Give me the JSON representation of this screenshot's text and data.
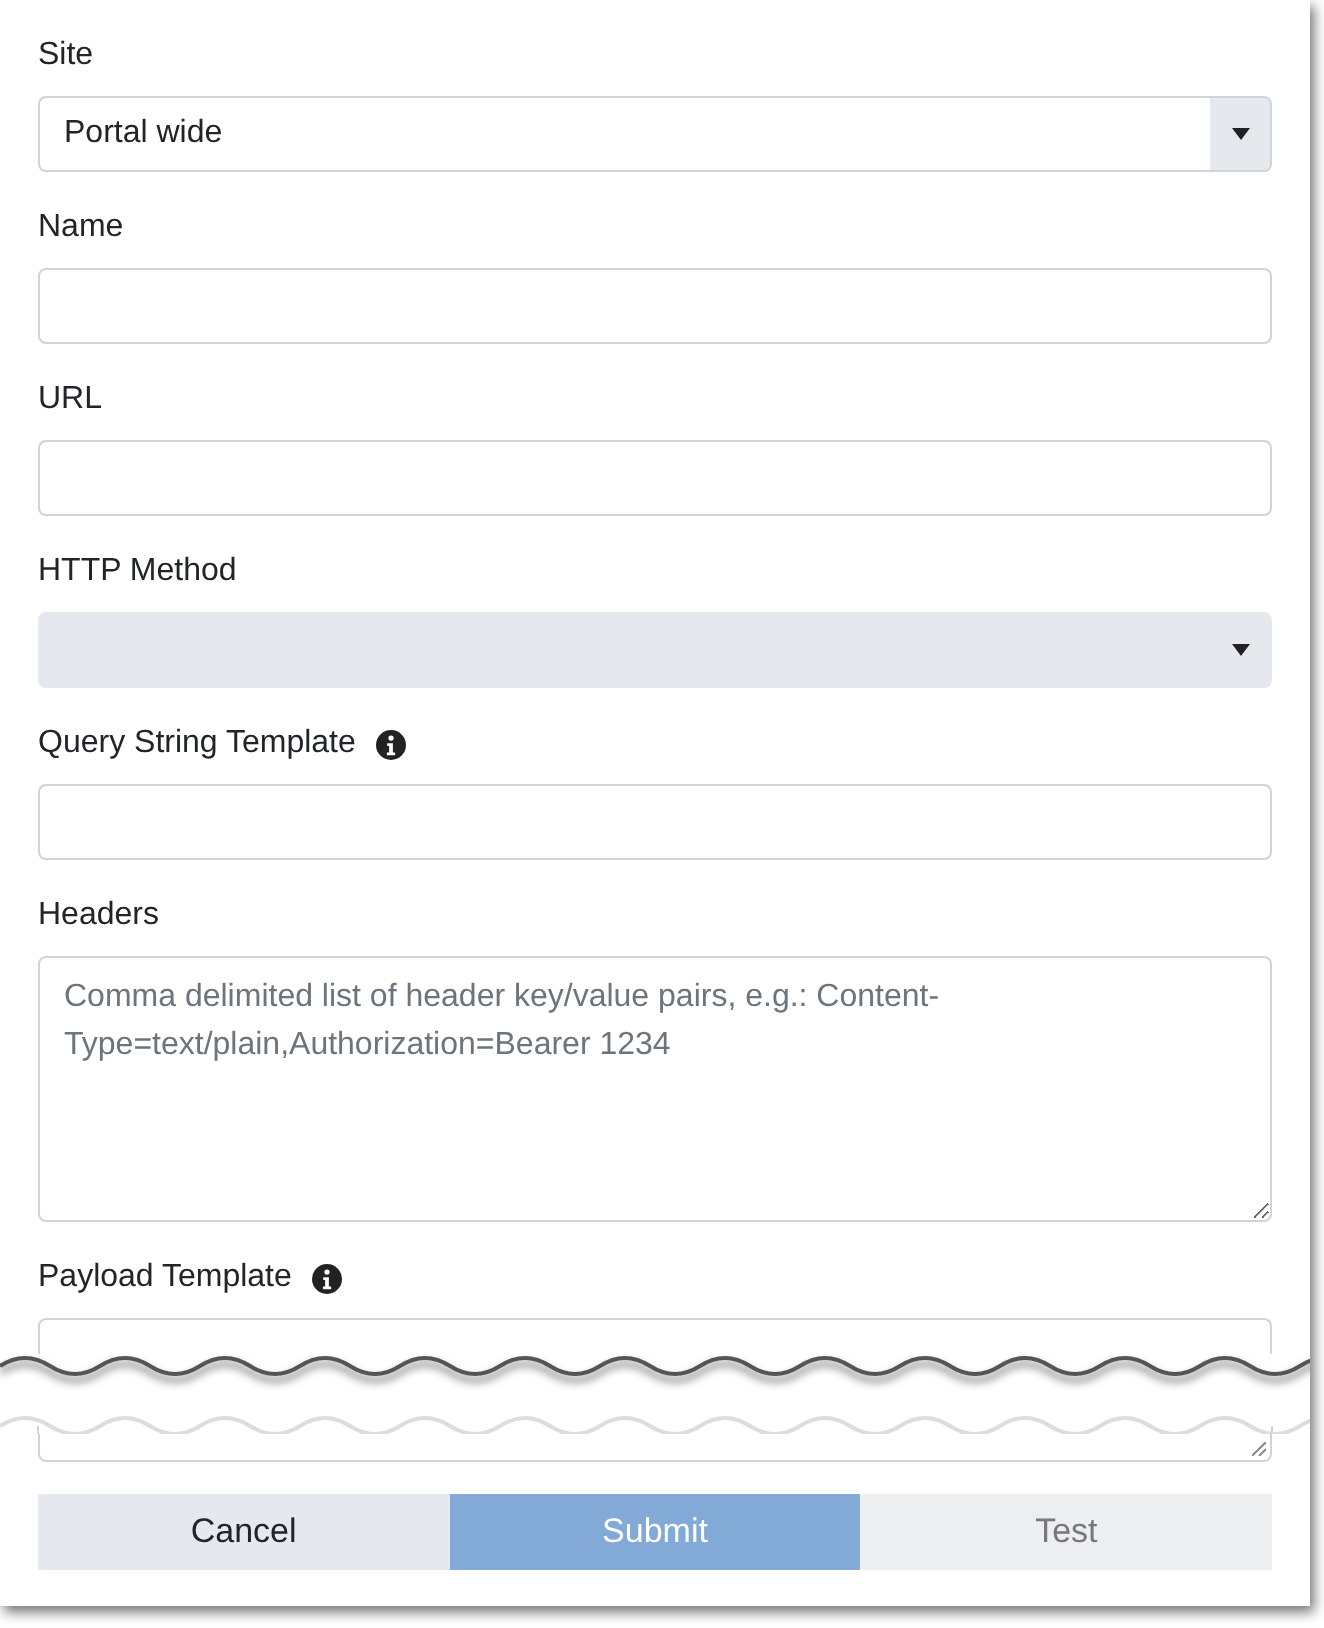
{
  "fields": [
    {
      "label": "Site",
      "kind": "select",
      "value": "Portal wide",
      "disabled": false,
      "info": false
    },
    {
      "label": "Name",
      "kind": "text",
      "info": false
    },
    {
      "label": "URL",
      "kind": "text",
      "info": false
    },
    {
      "label": "HTTP Method",
      "kind": "select",
      "disabled": true,
      "info": false
    },
    {
      "label": "Query String Template",
      "kind": "text",
      "info": true
    },
    {
      "label": "Headers",
      "kind": "textarea",
      "placeholder": "Comma delimited list of header key/value pairs, e.g.: Content-Type=text/plain,Authorization=Bearer 1234",
      "info": false
    },
    {
      "label": "Payload Template",
      "kind": "torn-textarea",
      "info": true
    }
  ],
  "buttons": [
    {
      "label": "Cancel",
      "kind": "secondary",
      "disabled": false
    },
    {
      "label": "Submit",
      "kind": "primary",
      "disabled": true
    },
    {
      "label": "Test",
      "kind": "secondary",
      "disabled": true
    }
  ]
}
